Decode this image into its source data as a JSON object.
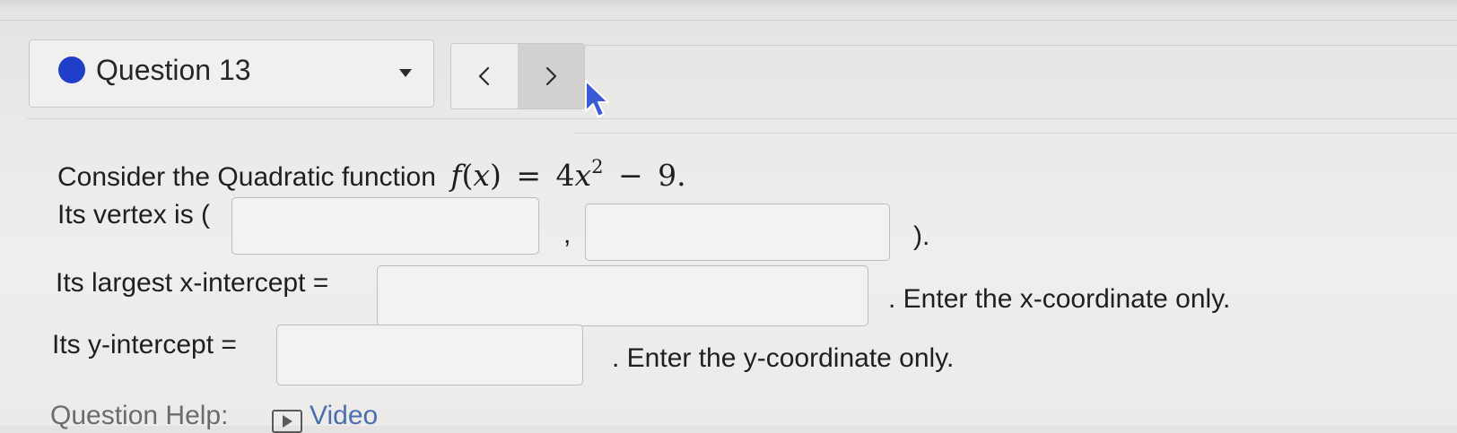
{
  "header": {
    "question_label": "Question 13",
    "status_color": "#1f3fc8",
    "dropdown_icon": "caret-down-icon",
    "prev_icon": "chevron-left-icon",
    "next_icon": "chevron-right-icon"
  },
  "question": {
    "intro_text": "Consider the Quadratic function",
    "function": {
      "name": "f",
      "variable": "x",
      "coefficient": "4",
      "exponent": "2",
      "operator": "−",
      "constant": "9",
      "end": "."
    },
    "vertex_prefix": "Its vertex is (",
    "vertex_separator": ",",
    "vertex_suffix": ").",
    "vertex_x_value": "",
    "vertex_y_value": "",
    "x_intercept_label": "Its largest x-intercept =",
    "x_intercept_value": "",
    "x_intercept_hint": ". Enter the x-coordinate only.",
    "y_intercept_label": "Its y-intercept =",
    "y_intercept_value": "",
    "y_intercept_hint": ". Enter the y-coordinate only."
  },
  "help": {
    "label": "Question Help:",
    "video_label": "Video",
    "video_icon": "video-icon"
  }
}
